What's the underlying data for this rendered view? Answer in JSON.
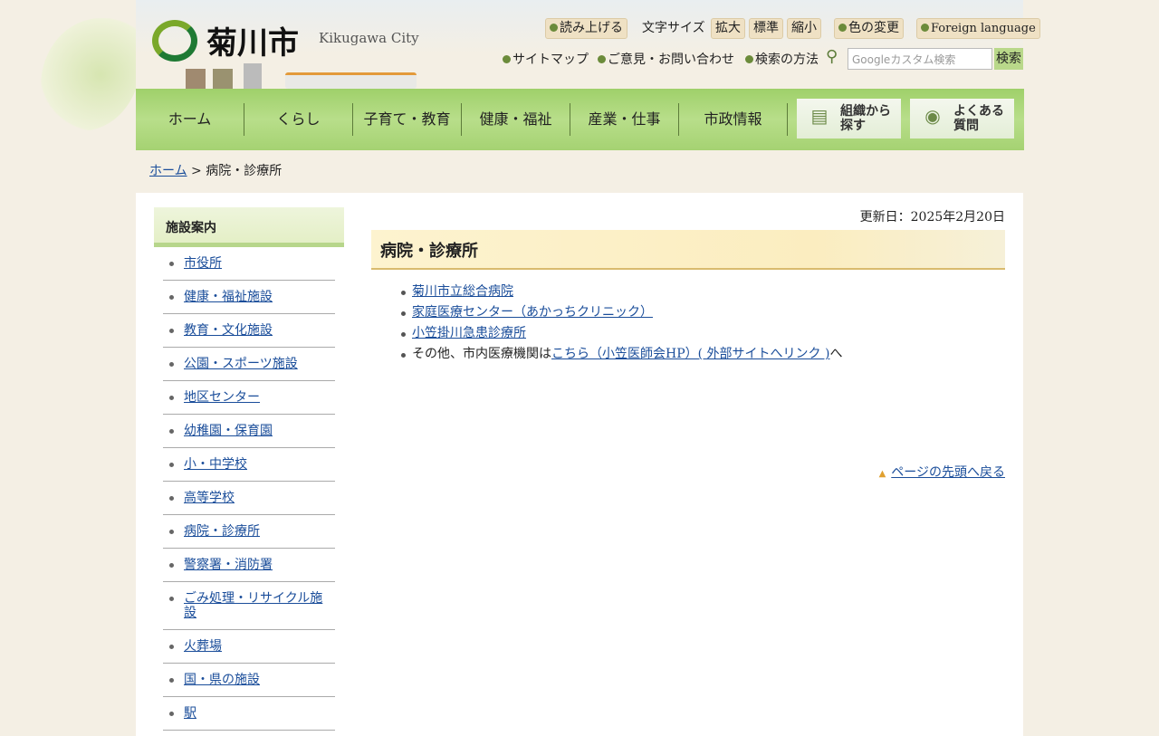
{
  "header": {
    "logo": "菊川市",
    "logo_sub": "Kikugawa City",
    "read_aloud": "読み上げる",
    "font_size_label": "文字サイズ",
    "font_sizes": [
      "拡大",
      "標準",
      "縮小"
    ],
    "color_change": "色の変更",
    "foreign": "Foreign language",
    "sitemap": "サイトマップ",
    "contact": "ご意見・お問い合わせ",
    "search_help": "検索の方法",
    "search_placeholder": "Googleカスタム検索",
    "search_button": "検索"
  },
  "nav": {
    "items": [
      "ホーム",
      "くらし",
      "子育て・教育",
      "健康・福祉",
      "産業・仕事",
      "市政情報"
    ],
    "org": "組織から探す",
    "faq": "よくある質問"
  },
  "breadcrumb": {
    "home": "ホーム",
    "sep": " > ",
    "current": "病院・診療所"
  },
  "sidebar": {
    "title": "施設案内",
    "items": [
      "市役所",
      "健康・福祉施設",
      "教育・文化施設",
      "公園・スポーツ施設",
      "地区センター",
      "幼稚園・保育園",
      "小・中学校",
      "高等学校",
      "病院・診療所",
      "警察署・消防署",
      "ごみ処理・リサイクル施設",
      "火葬場",
      "国・県の施設",
      "駅"
    ]
  },
  "content": {
    "updated": "更新日：2025年2月20日",
    "title": "病院・診療所",
    "links": [
      "菊川市立総合病院",
      "家庭医療センター（あかっちクリニック）",
      "小笠掛川急患診療所"
    ],
    "other_prefix": "その他、市内医療機関は",
    "other_link": "こちら（小笠医師会HP）( 外部サイトへリンク )",
    "other_suffix": "へ",
    "page_top": "ページの先頭へ戻る"
  }
}
